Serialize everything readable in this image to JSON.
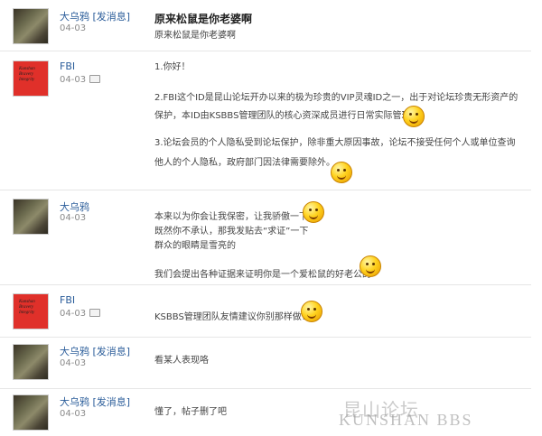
{
  "thread": {
    "title": "原来松鼠是你老婆啊",
    "subtitle": "原来松鼠是你老婆啊"
  },
  "posts": [
    {
      "user": "大乌鸦",
      "send_msg": "[发消息]",
      "date": "04-03"
    },
    {
      "user": "FBI",
      "date": "04-03",
      "avatar_text": [
        "Kunshan",
        "Bravery",
        "Integrity"
      ],
      "lines": [
        "1.你好！",
        "2.FBI这个ID是昆山论坛开办以来的极为珍贵的VIP灵魂ID之一，出于对论坛珍贵无形资产的",
        "保护，本ID由KSBBS管理团队的核心资深成员进行日常实际管理。",
        "3.论坛会员的个人隐私受到论坛保护，除非重大原因事故，论坛不接受任何个人或单位查询",
        "他人的个人隐私，政府部门因法律需要除外。"
      ]
    },
    {
      "user": "大乌鸦",
      "date": "04-03",
      "lines": [
        "本来以为你会让我保密，让我骄傲一下",
        "既然你不承认，那我发贴去“求证”一下",
        "群众的眼睛是雪亮的",
        "我们会提出各种证据来证明你是一个爱松鼠的好老公的"
      ]
    },
    {
      "user": "FBI",
      "date": "04-03",
      "avatar_text": [
        "Kunshan",
        "Bravery",
        "Integrity"
      ],
      "lines": [
        "KSBBS管理团队友情建议你别那样做！"
      ]
    },
    {
      "user": "大乌鸦",
      "send_msg": "[发消息]",
      "date": "04-03",
      "lines": [
        "看某人表现咯"
      ]
    },
    {
      "user": "大乌鸦",
      "send_msg": "[发消息]",
      "date": "04-03",
      "lines": [
        "懂了，帖子删了吧"
      ]
    }
  ],
  "watermark": {
    "cn": "昆山论坛",
    "en": "KUNSHAN BBS"
  }
}
